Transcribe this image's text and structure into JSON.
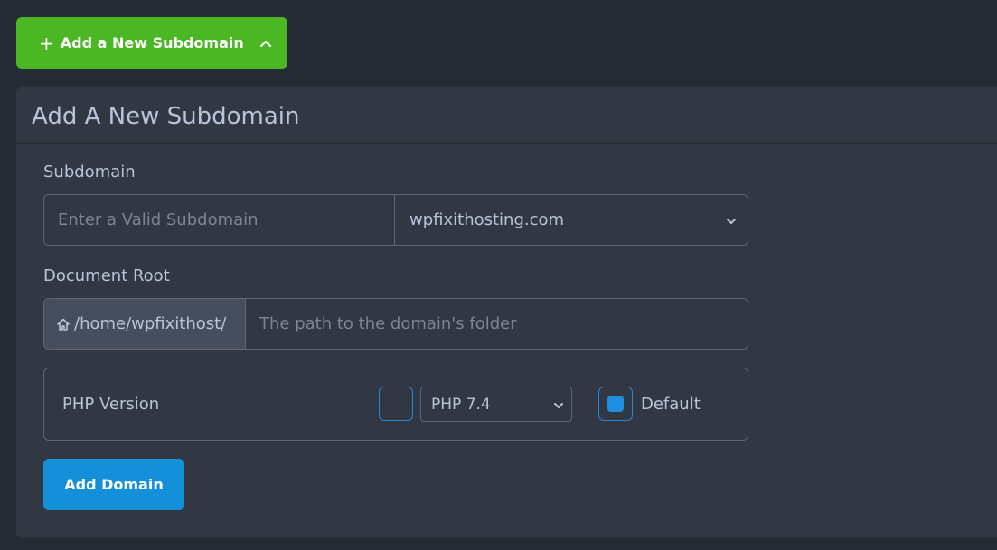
{
  "toggle": {
    "icon": "plus-icon",
    "label": "Add a New Subdomain",
    "chevron": "chevron-up-icon",
    "color": "#4cb725"
  },
  "form": {
    "title": "Add A New Subdomain",
    "subdomain": {
      "label": "Subdomain",
      "placeholder": "Enter a Valid Subdomain",
      "value": "",
      "domain_selected": "wpfixithosting.com"
    },
    "document_root": {
      "label": "Document Root",
      "prefix_icon": "home-icon",
      "prefix": "/home/wpfixithost/",
      "placeholder": "The path to the domain's folder",
      "value": ""
    },
    "php": {
      "label": "PHP Version",
      "enabled_checked": false,
      "version_selected": "PHP 7.4",
      "default_checked": true,
      "default_label": "Default"
    },
    "submit_label": "Add Domain",
    "accent": "#1390d8"
  }
}
